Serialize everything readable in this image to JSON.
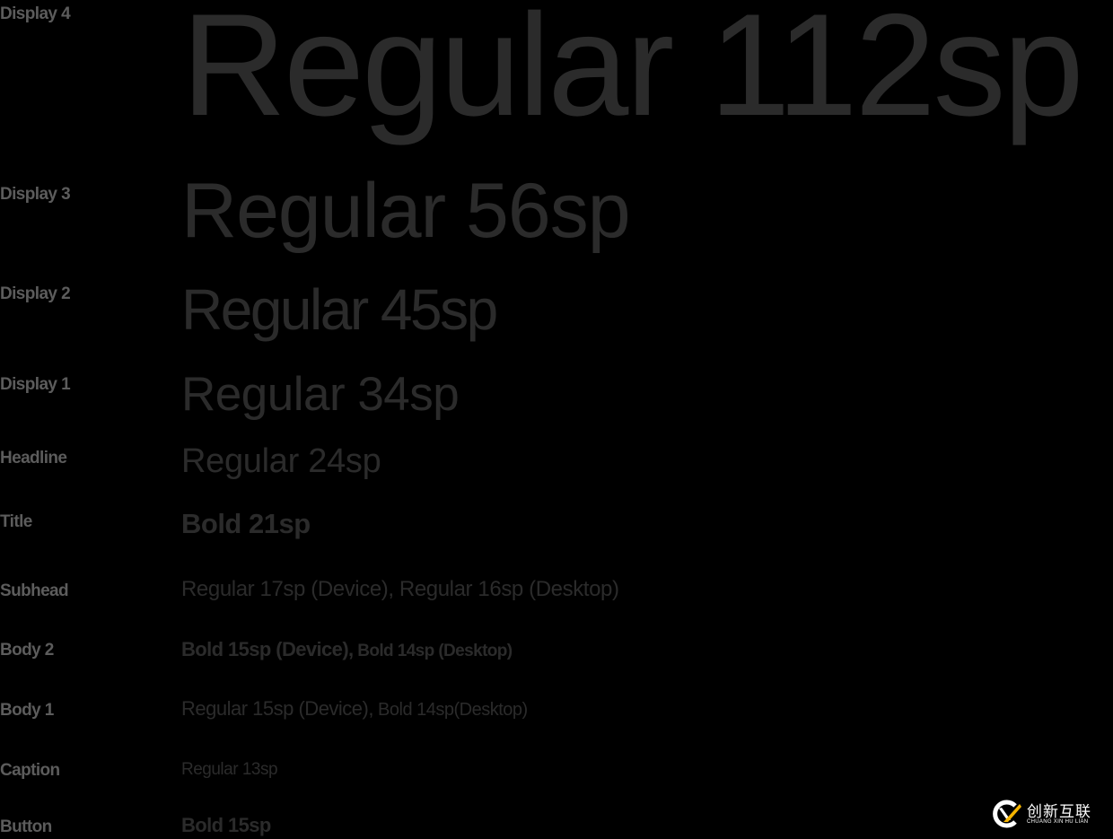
{
  "rows": [
    {
      "label": "Display 4",
      "sample": "Regular 112sp"
    },
    {
      "label": "Display 3",
      "sample": "Regular 56sp"
    },
    {
      "label": "Display 2",
      "sample": "Regular 45sp"
    },
    {
      "label": "Display 1",
      "sample": "Regular 34sp"
    },
    {
      "label": "Headline",
      "sample": "Regular 24sp"
    },
    {
      "label": "Title",
      "sample": "Bold 21sp"
    },
    {
      "label": "Subhead",
      "sample": "Regular 17sp (Device), Regular 16sp (Desktop)"
    },
    {
      "label": "Body 2",
      "sample": "Bold 15sp (Device),",
      "sample2": " Bold 14sp (Desktop)"
    },
    {
      "label": "Body 1",
      "sample": "Regular 15sp  (Device),",
      "sample2": " Bold 14sp(Desktop)"
    },
    {
      "label": "Caption",
      "sample": "Regular 13sp"
    },
    {
      "label": "Button",
      "sample": "Bold 15sp"
    }
  ],
  "watermark": {
    "name_cn": "创新互联",
    "name_en": "CHUANG XIN HU LIAN",
    "icon": "cx-logo-icon",
    "colors": {
      "accent": "#f5b400",
      "text": "#ffffff"
    }
  },
  "colors": {
    "background": "#000000",
    "label": "#5c5c5c",
    "sample": "#2b2b2b"
  }
}
